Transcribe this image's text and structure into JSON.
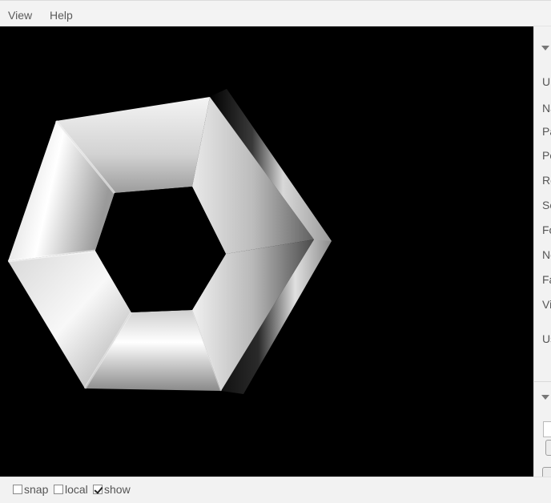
{
  "menu": {
    "view_label": "View",
    "help_label": "Help"
  },
  "viewport": {
    "background": "#000000",
    "object": "hexagonal-torus-mesh"
  },
  "bottom_bar": {
    "snap_label": "snap",
    "snap_checked": false,
    "local_label": "local",
    "local_checked": false,
    "show_label": "show",
    "show_checked": true
  },
  "side_panel": {
    "property_labels": [
      "UU",
      "Na",
      "Pa",
      "Po",
      "Ro",
      "Sc",
      "Fo",
      "Ne",
      "Fa",
      "Vi",
      "Us"
    ]
  }
}
